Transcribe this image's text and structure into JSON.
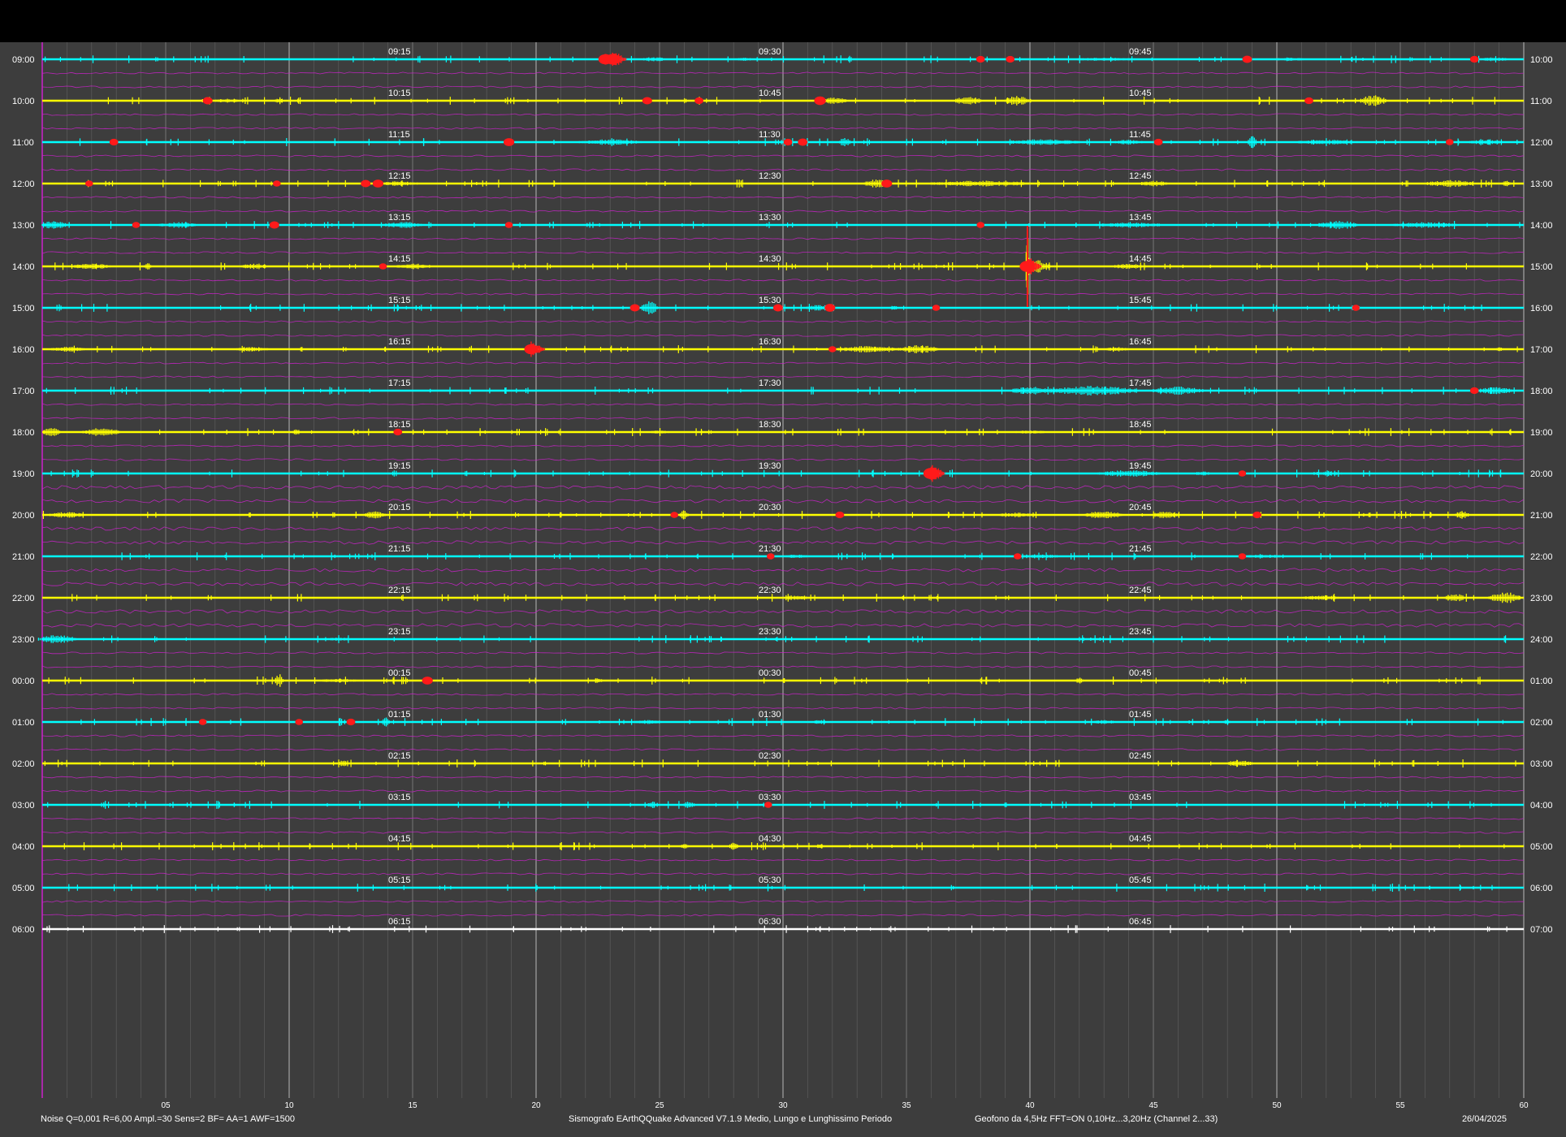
{
  "chart_data": {
    "type": "line",
    "title": "",
    "xlabel": "",
    "ylabel": "",
    "xlim": [
      0,
      60
    ],
    "grid": true,
    "x_ticks": [
      "05",
      "10",
      "15",
      "20",
      "25",
      "30",
      "35",
      "40",
      "45",
      "50",
      "55",
      "60"
    ],
    "quarter_labels": [
      "15",
      "30",
      "45"
    ],
    "rows": [
      {
        "left": "09:00",
        "right": "10:00",
        "q15": "09:15",
        "q30": "09:30",
        "q45": "09:45",
        "color": "#00ffff",
        "events": [
          [
            22.8,
            0.9
          ],
          [
            23.1,
            1.0
          ],
          [
            38,
            0.4
          ],
          [
            39.2,
            0.4
          ],
          [
            48.8,
            0.5
          ],
          [
            58,
            0.4
          ]
        ],
        "bursts": [
          [
            24.8,
            1.0,
            0.3
          ],
          [
            28.5,
            1.0,
            0.2
          ],
          [
            43,
            3.0,
            0.2
          ],
          [
            50.5,
            1.5,
            0.2
          ],
          [
            58.8,
            1.2,
            0.25
          ]
        ]
      },
      {
        "left": "10:00",
        "right": "11:00",
        "q15": "10:15",
        "q30": "10:45",
        "q45": "10:45",
        "color": "#ffff00",
        "events": [
          [
            6.7,
            0.5
          ],
          [
            24.5,
            0.5
          ],
          [
            26.6,
            0.4
          ],
          [
            31.5,
            0.7
          ],
          [
            51.3,
            0.4
          ]
        ],
        "bursts": [
          [
            7.5,
            1.2,
            0.25
          ],
          [
            9.6,
            0.3,
            0.4
          ],
          [
            32,
            1.2,
            0.4
          ],
          [
            37.5,
            1.0,
            0.55
          ],
          [
            39.5,
            1.0,
            0.6
          ],
          [
            53.9,
            1.0,
            0.7
          ]
        ]
      },
      {
        "left": "11:00",
        "right": "12:00",
        "q15": "11:15",
        "q30": "11:30",
        "q45": "11:45",
        "color": "#00ffff",
        "events": [
          [
            2.9,
            0.4
          ],
          [
            18.9,
            0.6
          ],
          [
            30.2,
            0.4
          ],
          [
            30.8,
            0.5
          ],
          [
            45.2,
            0.4
          ],
          [
            57,
            0.3
          ]
        ],
        "bursts": [
          [
            23,
            2.5,
            0.35
          ],
          [
            32.5,
            0.4,
            0.6
          ],
          [
            40.5,
            3.0,
            0.35
          ],
          [
            44,
            1.2,
            0.3
          ],
          [
            49,
            0.3,
            1.0
          ],
          [
            52,
            2.5,
            0.3
          ],
          [
            58.5,
            1.5,
            0.3
          ]
        ]
      },
      {
        "left": "12:00",
        "right": "13:00",
        "q15": "12:15",
        "q30": "12:30",
        "q45": "12:45",
        "color": "#ffff00",
        "events": [
          [
            1.9,
            0.3
          ],
          [
            9.5,
            0.3
          ],
          [
            13.1,
            0.5
          ],
          [
            13.6,
            0.6
          ],
          [
            34.2,
            0.6
          ]
        ],
        "bursts": [
          [
            14.5,
            1.5,
            0.3
          ],
          [
            33.8,
            1.0,
            0.5
          ],
          [
            38,
            4.0,
            0.35
          ],
          [
            45,
            1.2,
            0.35
          ],
          [
            57,
            1.8,
            0.45
          ],
          [
            59.3,
            0.3,
            0.4
          ]
        ]
      },
      {
        "left": "13:00",
        "right": "14:00",
        "q15": "13:15",
        "q30": "13:30",
        "q45": "13:45",
        "color": "#00ffff",
        "events": [
          [
            3.8,
            0.3
          ],
          [
            9.4,
            0.5
          ],
          [
            18.9,
            0.3
          ],
          [
            38,
            0.3
          ]
        ],
        "bursts": [
          [
            0.5,
            1.0,
            0.5
          ],
          [
            5.5,
            1.5,
            0.35
          ],
          [
            14.6,
            1.5,
            0.4
          ],
          [
            44,
            3.0,
            0.3
          ],
          [
            52.5,
            1.5,
            0.5
          ],
          [
            56,
            2.5,
            0.35
          ]
        ]
      },
      {
        "left": "14:00",
        "right": "15:00",
        "q15": "14:15",
        "q30": "14:30",
        "q45": "14:45",
        "color": "#ffff00",
        "events": [
          [
            13.8,
            0.3
          ],
          [
            39.9,
            1.1
          ]
        ],
        "bursts": [
          [
            2,
            1.5,
            0.35
          ],
          [
            4.3,
            0.3,
            0.4
          ],
          [
            8.6,
            1.0,
            0.35
          ],
          [
            15,
            1.5,
            0.35
          ],
          [
            39.9,
            0.1,
            4.5
          ],
          [
            40.3,
            1.0,
            0.8
          ],
          [
            44,
            1.5,
            0.3
          ]
        ]
      },
      {
        "left": "15:00",
        "right": "16:00",
        "q15": "15:15",
        "q30": "15:30",
        "q45": "15:45",
        "color": "#00ffff",
        "events": [
          [
            24,
            0.5
          ],
          [
            29.8,
            0.5
          ],
          [
            31.9,
            0.6
          ],
          [
            36.2,
            0.3
          ],
          [
            53.2,
            0.3
          ]
        ],
        "bursts": [
          [
            24.6,
            0.6,
            0.8
          ],
          [
            31.5,
            1.2,
            0.35
          ],
          [
            34.5,
            0.3,
            0.3
          ]
        ]
      },
      {
        "left": "16:00",
        "right": "17:00",
        "q15": "16:15",
        "q30": "16:30",
        "q45": "16:45",
        "color": "#ffff00",
        "events": [
          [
            19.8,
            0.9
          ],
          [
            32,
            0.3
          ]
        ],
        "bursts": [
          [
            1,
            1.5,
            0.3
          ],
          [
            8.5,
            1.5,
            0.25
          ],
          [
            33.5,
            2.5,
            0.4
          ],
          [
            35.5,
            1.5,
            0.5
          ],
          [
            43.5,
            1.0,
            0.25
          ],
          [
            59,
            0.3,
            0.3
          ]
        ]
      },
      {
        "left": "17:00",
        "right": "18:00",
        "q15": "17:15",
        "q30": "17:30",
        "q45": "17:45",
        "color": "#00ffff",
        "events": [
          [
            58,
            0.4
          ]
        ],
        "bursts": [
          [
            40,
            1.5,
            0.5
          ],
          [
            42.5,
            3.5,
            0.6
          ],
          [
            46,
            2.0,
            0.5
          ],
          [
            58.8,
            1.5,
            0.45
          ]
        ]
      },
      {
        "left": "18:00",
        "right": "19:00",
        "q15": "18:15",
        "q30": "18:30",
        "q45": "18:45",
        "color": "#ffff00",
        "events": [
          [
            14.4,
            0.4
          ]
        ],
        "bursts": [
          [
            0.4,
            0.6,
            0.7
          ],
          [
            2.4,
            1.5,
            0.5
          ],
          [
            10.3,
            0.3,
            0.35
          ],
          [
            25,
            1.0,
            0.2
          ],
          [
            40,
            1.5,
            0.2
          ]
        ]
      },
      {
        "left": "19:00",
        "right": "20:00",
        "q15": "19:15",
        "q30": "19:30",
        "q45": "19:45",
        "color": "#00ffff",
        "events": [
          [
            36,
            1.1
          ],
          [
            48.6,
            0.3
          ]
        ],
        "bursts": [
          [
            44,
            2.5,
            0.4
          ],
          [
            47,
            0.6,
            0.3
          ],
          [
            52,
            1.5,
            0.25
          ]
        ]
      },
      {
        "left": "20:00",
        "right": "21:00",
        "q15": "20:15",
        "q30": "20:30",
        "q45": "20:45",
        "color": "#ffff00",
        "events": [
          [
            25.6,
            0.3
          ],
          [
            32.3,
            0.4
          ],
          [
            49.2,
            0.4
          ]
        ],
        "bursts": [
          [
            1,
            1.5,
            0.35
          ],
          [
            13.5,
            0.8,
            0.5
          ],
          [
            26,
            0.3,
            0.6
          ],
          [
            39.5,
            1.5,
            0.3
          ],
          [
            43,
            1.5,
            0.45
          ],
          [
            45.5,
            1.0,
            0.5
          ],
          [
            57.5,
            0.5,
            0.5
          ]
        ]
      },
      {
        "left": "21:00",
        "right": "22:00",
        "q15": "21:15",
        "q30": "21:30",
        "q45": "21:45",
        "color": "#00ffff",
        "events": [
          [
            29.5,
            0.3
          ],
          [
            39.5,
            0.3
          ],
          [
            48.6,
            0.3
          ]
        ],
        "bursts": [
          [
            30.5,
            1.0,
            0.25
          ],
          [
            40.5,
            2.0,
            0.2
          ],
          [
            49.5,
            1.5,
            0.25
          ]
        ]
      },
      {
        "left": "22:00",
        "right": "23:00",
        "q15": "22:15",
        "q30": "22:30",
        "q45": "22:45",
        "color": "#ffff00",
        "events": [],
        "bursts": [
          [
            30.5,
            1.0,
            0.3
          ],
          [
            51.8,
            1.5,
            0.3
          ],
          [
            57.2,
            0.8,
            0.5
          ],
          [
            59.2,
            1.2,
            0.75
          ]
        ]
      },
      {
        "left": "23:00",
        "right": "24:00",
        "q15": "23:15",
        "q30": "23:30",
        "q45": "23:45",
        "color": "#00ffff",
        "events": [],
        "bursts": [
          [
            0.6,
            1.5,
            0.5
          ],
          [
            12,
            1.0,
            0.2
          ]
        ]
      },
      {
        "left": "00:00",
        "right": "01:00",
        "q15": "00:15",
        "q30": "00:30",
        "q45": "00:45",
        "color": "#ffff00",
        "events": [
          [
            15.6,
            0.6
          ]
        ],
        "bursts": [
          [
            9.6,
            0.3,
            0.8
          ],
          [
            12,
            1.5,
            0.25
          ],
          [
            22.5,
            0.3,
            0.4
          ],
          [
            42,
            0.3,
            0.4
          ]
        ]
      },
      {
        "left": "01:00",
        "right": "02:00",
        "q15": "01:15",
        "q30": "01:30",
        "q45": "01:45",
        "color": "#00ffff",
        "events": [
          [
            6.5,
            0.3
          ],
          [
            10.4,
            0.3
          ],
          [
            12.5,
            0.4
          ]
        ],
        "bursts": [
          [
            13.9,
            0.3,
            0.6
          ],
          [
            24.5,
            1.5,
            0.25
          ],
          [
            31.5,
            0.5,
            0.3
          ],
          [
            43,
            1.0,
            0.25
          ],
          [
            48,
            0.3,
            0.3
          ]
        ]
      },
      {
        "left": "02:00",
        "right": "03:00",
        "q15": "02:15",
        "q30": "02:30",
        "q45": "02:45",
        "color": "#ffff00",
        "events": [],
        "bursts": [
          [
            12.2,
            0.3,
            0.5
          ],
          [
            48.5,
            1.0,
            0.45
          ]
        ]
      },
      {
        "left": "03:00",
        "right": "04:00",
        "q15": "03:15",
        "q30": "03:30",
        "q45": "03:45",
        "color": "#00ffff",
        "events": [
          [
            29.4,
            0.3
          ]
        ],
        "bursts": [
          [
            24.7,
            0.3,
            0.5
          ],
          [
            26.2,
            0.4,
            0.5
          ]
        ]
      },
      {
        "left": "04:00",
        "right": "05:00",
        "q15": "04:15",
        "q30": "04:30",
        "q45": "04:45",
        "color": "#ffff00",
        "events": [],
        "bursts": [
          [
            26,
            0.3,
            0.35
          ],
          [
            28,
            0.3,
            0.6
          ],
          [
            31.5,
            0.3,
            0.3
          ]
        ]
      },
      {
        "left": "05:00",
        "right": "06:00",
        "q15": "05:15",
        "q30": "05:30",
        "q45": "05:45",
        "color": "#00ffff",
        "events": [],
        "bursts": []
      },
      {
        "left": "06:00",
        "right": "07:00",
        "q15": "06:15",
        "q30": "06:30",
        "q45": "06:45",
        "color": "#ffffff",
        "events": [],
        "bursts": []
      }
    ],
    "colors": {
      "background": "#3d3d3d",
      "grid": "#8a8a8a",
      "noise": "#cc22cc",
      "event": "#ff1a1a",
      "label": "#ffffff"
    }
  },
  "footer": {
    "params": "Noise Q=0,001 R=6,00 Ampl.=30 Sens=2 BF= AA=1 AWF=1500",
    "software": "Sismografo  EArthQQuake Advanced V7.1.9  Medio, Lungo e Lunghissimo Periodo",
    "sensor": "Geofono da 4,5Hz FFT=ON 0,10Hz...3,20Hz      (Channel 2...33)",
    "date": "26/04/2025"
  }
}
